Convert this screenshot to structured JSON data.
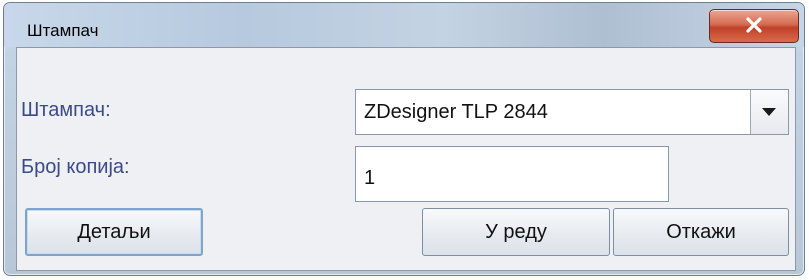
{
  "window": {
    "title": "Штампач",
    "close_glyph": "X"
  },
  "form": {
    "printer_label": "Штампач:",
    "printer_value": "ZDesigner TLP 2844",
    "copies_label": "Број копија:",
    "copies_value": "1"
  },
  "buttons": {
    "details": "Детаљи",
    "ok": "У реду",
    "cancel": "Откажи"
  },
  "icons": {
    "close": "close-icon",
    "dropdown": "chevron-down-icon"
  },
  "colors": {
    "label_text": "#3b4a8a",
    "close_button": "#c0412a"
  }
}
